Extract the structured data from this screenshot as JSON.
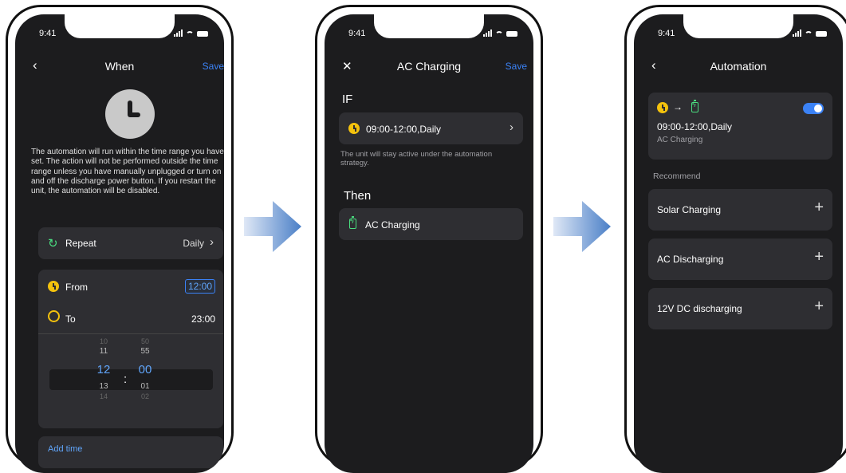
{
  "colors": {
    "accent": "#3b82f6",
    "clock": "#f4c20d",
    "battery": "#4ade80",
    "screen_bg": "#1c1c1e",
    "card_bg": "#2e2e32"
  },
  "phone1": {
    "status_time": "9:41",
    "title": "When",
    "save": "Save",
    "description": "The automation will run within the time range you have set. The action will not be performed outside the time range unless you have manually unplugged or turn on and off the discharge power button. If you restart the unit, the automation will be disabled.",
    "repeat_label": "Repeat",
    "repeat_value": "Daily",
    "from_label": "From",
    "from_value": "12:00",
    "to_label": "To",
    "to_value": "23:00",
    "picker": {
      "hours": [
        "10",
        "11",
        "12",
        "13",
        "14"
      ],
      "minutes": [
        "50",
        "55",
        "00",
        "01",
        "02"
      ],
      "separator": ":"
    },
    "add_time": "Add time"
  },
  "phone2": {
    "status_time": "9:41",
    "title": "AC Charging",
    "save": "Save",
    "if_label": "IF",
    "condition": "09:00-12:00,Daily",
    "note": "The unit will stay active under the automation strategy.",
    "then_label": "Then",
    "action": "AC Charging"
  },
  "phone3": {
    "status_time": "9:41",
    "title": "Automation",
    "arrow_glyph": "→",
    "card_time": "09:00-12:00,Daily",
    "card_action": "AC Charging",
    "toggle_on": true,
    "recommend_label": "Recommend",
    "recommend_items": [
      "Solar Charging",
      "AC Discharging",
      "12V DC discharging"
    ]
  }
}
